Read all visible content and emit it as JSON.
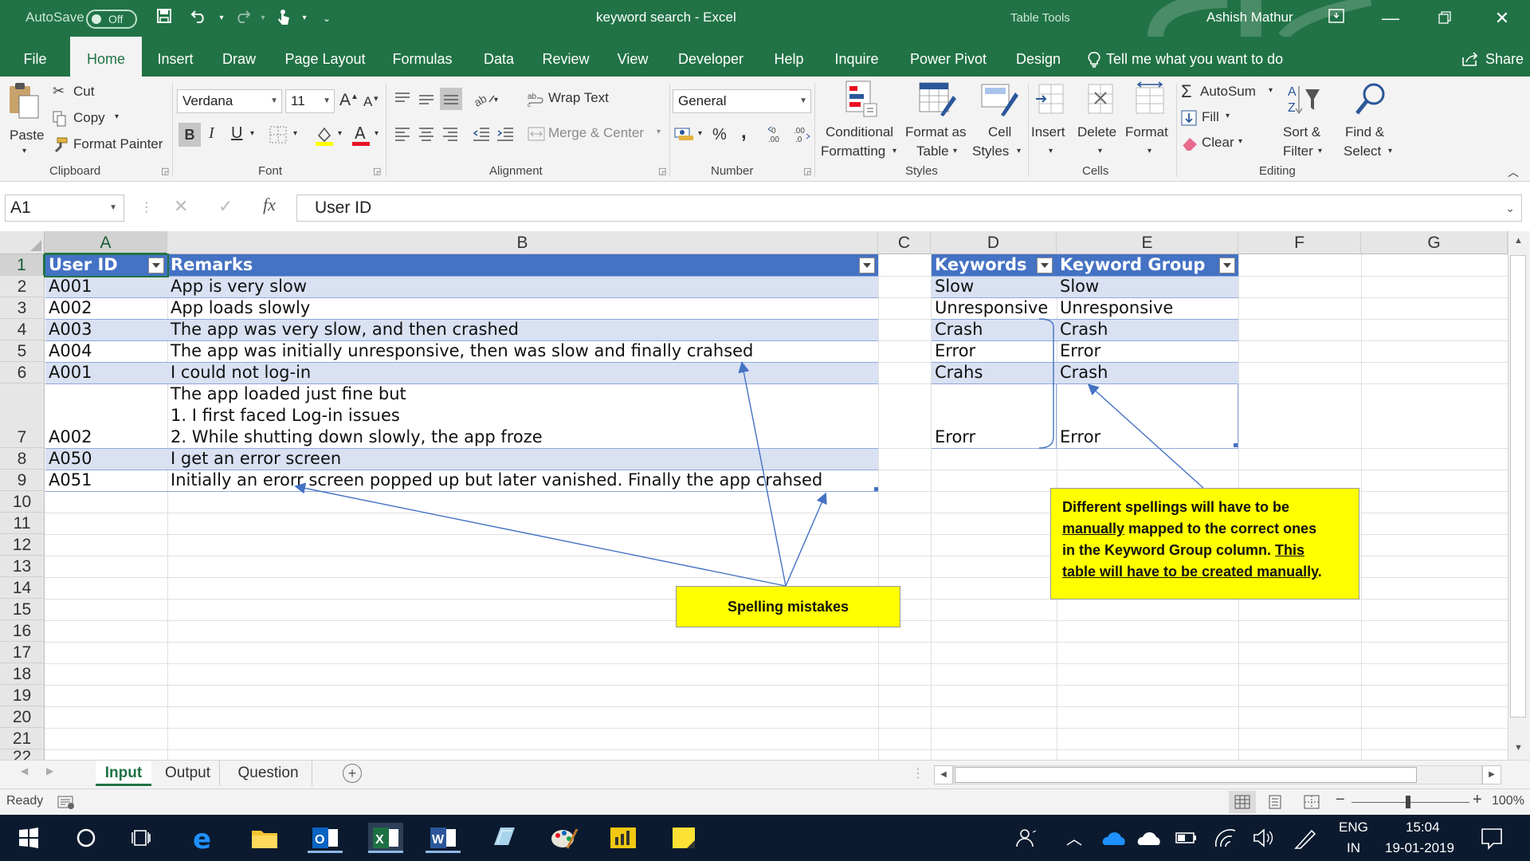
{
  "window": {
    "autosave_label": "AutoSave",
    "autosave_state": "Off",
    "title": "keyword search  -  Excel",
    "context_tab_label": "Table Tools",
    "user_name": "Ashish Mathur"
  },
  "ribbon_tabs": [
    "File",
    "Home",
    "Insert",
    "Draw",
    "Page Layout",
    "Formulas",
    "Data",
    "Review",
    "View",
    "Developer",
    "Help",
    "Inquire",
    "Power Pivot",
    "Design"
  ],
  "tell_me": "Tell me what you want to do",
  "share_label": "Share",
  "clipboard": {
    "paste": "Paste",
    "cut": "Cut",
    "copy": "Copy",
    "format_painter": "Format Painter",
    "group": "Clipboard"
  },
  "font": {
    "name": "Verdana",
    "size": "11",
    "group": "Font",
    "bold": "B",
    "italic": "I",
    "underline": "U"
  },
  "alignment": {
    "wrap_text": "Wrap Text",
    "merge_center": "Merge & Center",
    "group": "Alignment"
  },
  "number": {
    "format": "General",
    "percent": "%",
    "comma": ",",
    "group": "Number"
  },
  "styles": {
    "conditional_1": "Conditional",
    "conditional_2": "Formatting",
    "format_as_1": "Format as",
    "format_as_2": "Table",
    "cell_styles_1": "Cell",
    "cell_styles_2": "Styles",
    "group": "Styles"
  },
  "cells": {
    "insert": "Insert",
    "delete": "Delete",
    "format": "Format",
    "group": "Cells"
  },
  "editing": {
    "autosum": "AutoSum",
    "fill": "Fill",
    "clear": "Clear",
    "sort_1": "Sort &",
    "sort_2": "Filter",
    "find_1": "Find &",
    "find_2": "Select",
    "group": "Editing"
  },
  "formula_bar": {
    "name_box": "A1",
    "fx": "fx",
    "content": "User ID"
  },
  "columns": [
    "A",
    "B",
    "C",
    "D",
    "E",
    "F",
    "G"
  ],
  "rows": [
    "1",
    "2",
    "3",
    "4",
    "5",
    "6",
    "7",
    "8",
    "9",
    "10",
    "11",
    "12",
    "13",
    "14",
    "15",
    "16",
    "17",
    "18",
    "19",
    "20",
    "21",
    "22"
  ],
  "input_table": {
    "headers": [
      "User ID",
      "Remarks"
    ],
    "rows": [
      {
        "id": "A001",
        "remarks": [
          "App is very slow"
        ]
      },
      {
        "id": "A002",
        "remarks": [
          "App loads slowly"
        ]
      },
      {
        "id": "A003",
        "remarks": [
          "The app was very slow, and then crashed"
        ]
      },
      {
        "id": "A004",
        "remarks": [
          "The app was initially unresponsive, then was slow and finally crahsed"
        ]
      },
      {
        "id": "A001",
        "remarks": [
          "I could not log-in"
        ]
      },
      {
        "id": "A002",
        "remarks": [
          "The app loaded just fine but",
          "1. I first faced Log-in issues",
          "2. While shutting down slowly, the app froze"
        ]
      },
      {
        "id": "A050",
        "remarks": [
          "I get an error screen"
        ]
      },
      {
        "id": "A051",
        "remarks": [
          "Initially an erorr screen popped up but later vanished.  Finally the app crahsed"
        ]
      }
    ]
  },
  "keyword_table": {
    "headers": [
      "Keywords",
      "Keyword Group"
    ],
    "rows": [
      [
        "Slow",
        "Slow"
      ],
      [
        "Unresponsive",
        "Unresponsive"
      ],
      [
        "Crash",
        "Crash"
      ],
      [
        "Error",
        "Error"
      ],
      [
        "Crahs",
        "Crash"
      ],
      [
        "Erorr",
        "Error"
      ]
    ]
  },
  "callouts": {
    "spelling": "Spelling mistakes",
    "mapping_1": "Different spellings will have to be",
    "mapping_2a": "manually",
    "mapping_2b": " mapped to the correct ones",
    "mapping_3a": "in the Keyword Group column.  ",
    "mapping_3b": "This",
    "mapping_4": "table will have to be created manually",
    "mapping_4_end": "."
  },
  "sheets": [
    "Input",
    "Output",
    "Question"
  ],
  "status": {
    "ready": "Ready",
    "zoom": "100%",
    "minus": "−",
    "plus": "+"
  },
  "taskbar": {
    "lang_1": "ENG",
    "lang_2": "IN",
    "time": "15:04",
    "date": "19-01-2019"
  },
  "colors": {
    "excel_green": "#217346",
    "table_header": "#4472c4",
    "table_band": "#d9e1f2",
    "callout": "#ffff00"
  }
}
